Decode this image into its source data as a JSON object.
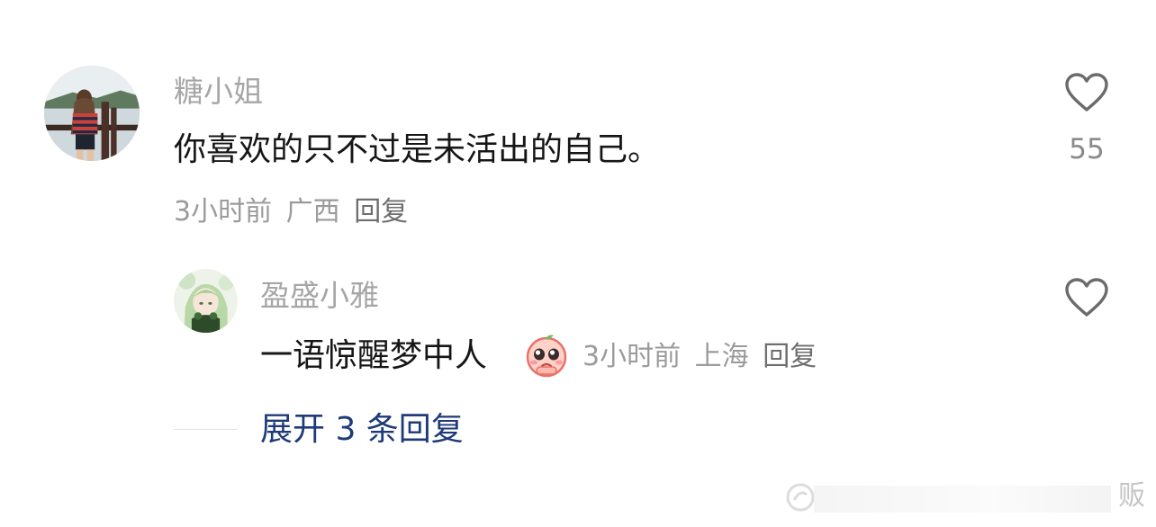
{
  "comment": {
    "username": "糖小姐",
    "text": "你喜欢的只不过是未活出的自己。",
    "time": "3小时前",
    "location": "广西",
    "reply_label": "回复",
    "likes": "55"
  },
  "reply": {
    "username": "盈盛小雅",
    "text": "一语惊醒梦中人",
    "emoji_icon": "pleading-face-emoji",
    "time": "3小时前",
    "location": "上海",
    "reply_label": "回复"
  },
  "expand": {
    "label": "展开 3 条回复"
  },
  "watermark": {
    "text": "贩"
  },
  "colors": {
    "username": "#a6a6a6",
    "text": "#161616",
    "meta": "#9b9b9b",
    "expand": "#1e3a78"
  }
}
